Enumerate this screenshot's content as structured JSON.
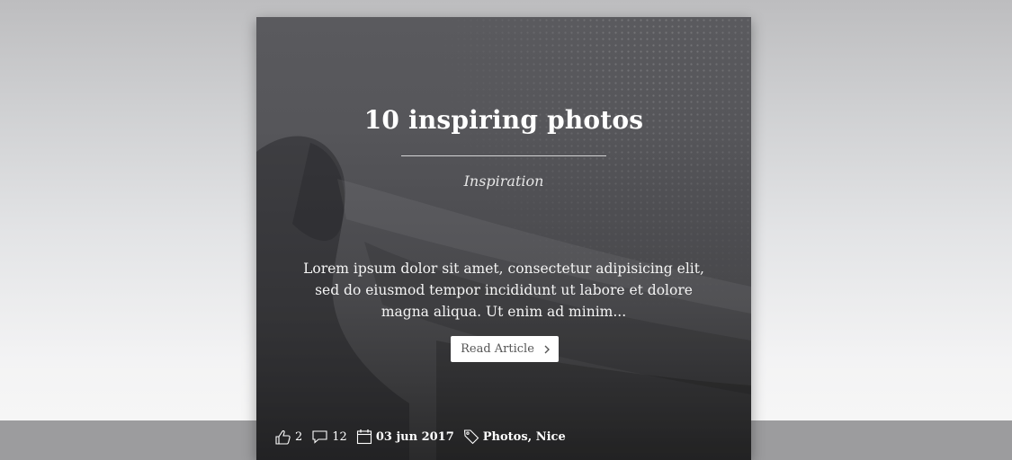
{
  "card": {
    "title": "10 inspiring photos",
    "category": "Inspiration",
    "excerpt": "Lorem ipsum dolor sit amet, consectetur adipisicing elit, sed do eiusmod tempor incididunt ut labore et dolore magna aliqua. Ut enim ad minim...",
    "read_button_label": "Read Article",
    "read_button_icon": "chevron-right-icon"
  },
  "meta": {
    "likes": {
      "icon": "thumbs-up-icon",
      "count": "2"
    },
    "comments": {
      "icon": "comment-icon",
      "count": "12"
    },
    "date": {
      "icon": "calendar-icon",
      "value": "03 jun 2017"
    },
    "tags": {
      "icon": "tag-icon",
      "value": "Photos, Nice"
    }
  },
  "colors": {
    "card_overlay": "#4e4e52",
    "text": "#ffffff",
    "button_bg": "#ffffff",
    "button_text": "#555555",
    "page_floor": "#9c9c9e"
  }
}
